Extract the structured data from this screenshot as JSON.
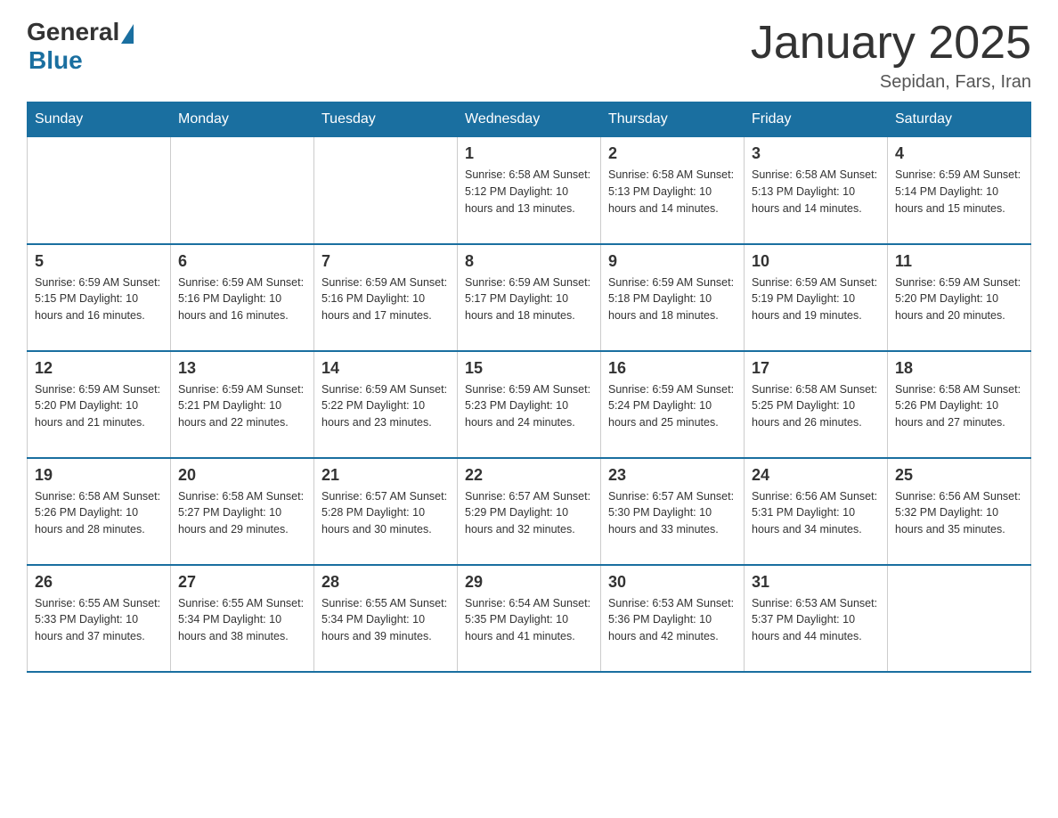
{
  "header": {
    "logo_general": "General",
    "logo_blue": "Blue",
    "title": "January 2025",
    "subtitle": "Sepidan, Fars, Iran"
  },
  "days_of_week": [
    "Sunday",
    "Monday",
    "Tuesday",
    "Wednesday",
    "Thursday",
    "Friday",
    "Saturday"
  ],
  "weeks": [
    [
      {
        "day": "",
        "info": ""
      },
      {
        "day": "",
        "info": ""
      },
      {
        "day": "",
        "info": ""
      },
      {
        "day": "1",
        "info": "Sunrise: 6:58 AM\nSunset: 5:12 PM\nDaylight: 10 hours\nand 13 minutes."
      },
      {
        "day": "2",
        "info": "Sunrise: 6:58 AM\nSunset: 5:13 PM\nDaylight: 10 hours\nand 14 minutes."
      },
      {
        "day": "3",
        "info": "Sunrise: 6:58 AM\nSunset: 5:13 PM\nDaylight: 10 hours\nand 14 minutes."
      },
      {
        "day": "4",
        "info": "Sunrise: 6:59 AM\nSunset: 5:14 PM\nDaylight: 10 hours\nand 15 minutes."
      }
    ],
    [
      {
        "day": "5",
        "info": "Sunrise: 6:59 AM\nSunset: 5:15 PM\nDaylight: 10 hours\nand 16 minutes."
      },
      {
        "day": "6",
        "info": "Sunrise: 6:59 AM\nSunset: 5:16 PM\nDaylight: 10 hours\nand 16 minutes."
      },
      {
        "day": "7",
        "info": "Sunrise: 6:59 AM\nSunset: 5:16 PM\nDaylight: 10 hours\nand 17 minutes."
      },
      {
        "day": "8",
        "info": "Sunrise: 6:59 AM\nSunset: 5:17 PM\nDaylight: 10 hours\nand 18 minutes."
      },
      {
        "day": "9",
        "info": "Sunrise: 6:59 AM\nSunset: 5:18 PM\nDaylight: 10 hours\nand 18 minutes."
      },
      {
        "day": "10",
        "info": "Sunrise: 6:59 AM\nSunset: 5:19 PM\nDaylight: 10 hours\nand 19 minutes."
      },
      {
        "day": "11",
        "info": "Sunrise: 6:59 AM\nSunset: 5:20 PM\nDaylight: 10 hours\nand 20 minutes."
      }
    ],
    [
      {
        "day": "12",
        "info": "Sunrise: 6:59 AM\nSunset: 5:20 PM\nDaylight: 10 hours\nand 21 minutes."
      },
      {
        "day": "13",
        "info": "Sunrise: 6:59 AM\nSunset: 5:21 PM\nDaylight: 10 hours\nand 22 minutes."
      },
      {
        "day": "14",
        "info": "Sunrise: 6:59 AM\nSunset: 5:22 PM\nDaylight: 10 hours\nand 23 minutes."
      },
      {
        "day": "15",
        "info": "Sunrise: 6:59 AM\nSunset: 5:23 PM\nDaylight: 10 hours\nand 24 minutes."
      },
      {
        "day": "16",
        "info": "Sunrise: 6:59 AM\nSunset: 5:24 PM\nDaylight: 10 hours\nand 25 minutes."
      },
      {
        "day": "17",
        "info": "Sunrise: 6:58 AM\nSunset: 5:25 PM\nDaylight: 10 hours\nand 26 minutes."
      },
      {
        "day": "18",
        "info": "Sunrise: 6:58 AM\nSunset: 5:26 PM\nDaylight: 10 hours\nand 27 minutes."
      }
    ],
    [
      {
        "day": "19",
        "info": "Sunrise: 6:58 AM\nSunset: 5:26 PM\nDaylight: 10 hours\nand 28 minutes."
      },
      {
        "day": "20",
        "info": "Sunrise: 6:58 AM\nSunset: 5:27 PM\nDaylight: 10 hours\nand 29 minutes."
      },
      {
        "day": "21",
        "info": "Sunrise: 6:57 AM\nSunset: 5:28 PM\nDaylight: 10 hours\nand 30 minutes."
      },
      {
        "day": "22",
        "info": "Sunrise: 6:57 AM\nSunset: 5:29 PM\nDaylight: 10 hours\nand 32 minutes."
      },
      {
        "day": "23",
        "info": "Sunrise: 6:57 AM\nSunset: 5:30 PM\nDaylight: 10 hours\nand 33 minutes."
      },
      {
        "day": "24",
        "info": "Sunrise: 6:56 AM\nSunset: 5:31 PM\nDaylight: 10 hours\nand 34 minutes."
      },
      {
        "day": "25",
        "info": "Sunrise: 6:56 AM\nSunset: 5:32 PM\nDaylight: 10 hours\nand 35 minutes."
      }
    ],
    [
      {
        "day": "26",
        "info": "Sunrise: 6:55 AM\nSunset: 5:33 PM\nDaylight: 10 hours\nand 37 minutes."
      },
      {
        "day": "27",
        "info": "Sunrise: 6:55 AM\nSunset: 5:34 PM\nDaylight: 10 hours\nand 38 minutes."
      },
      {
        "day": "28",
        "info": "Sunrise: 6:55 AM\nSunset: 5:34 PM\nDaylight: 10 hours\nand 39 minutes."
      },
      {
        "day": "29",
        "info": "Sunrise: 6:54 AM\nSunset: 5:35 PM\nDaylight: 10 hours\nand 41 minutes."
      },
      {
        "day": "30",
        "info": "Sunrise: 6:53 AM\nSunset: 5:36 PM\nDaylight: 10 hours\nand 42 minutes."
      },
      {
        "day": "31",
        "info": "Sunrise: 6:53 AM\nSunset: 5:37 PM\nDaylight: 10 hours\nand 44 minutes."
      },
      {
        "day": "",
        "info": ""
      }
    ]
  ]
}
